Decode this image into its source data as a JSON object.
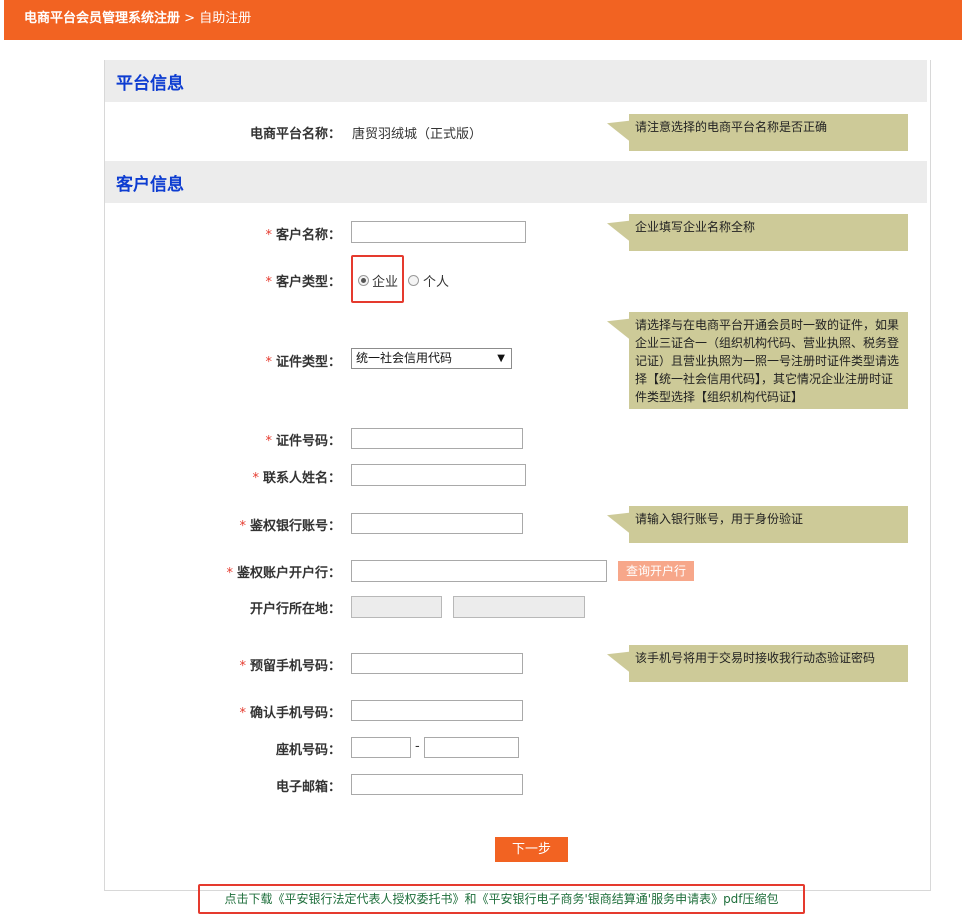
{
  "header": {
    "system_title": "电商平台会员管理系统注册",
    "separator": ">",
    "current_page": "自助注册"
  },
  "colors": {
    "brand": "#f26322",
    "section_title": "#0d3cd1",
    "tip_bg": "#cdca98",
    "required": "#e53a2e",
    "highlight_border": "#e53a2e"
  },
  "platform_section": {
    "title": "平台信息",
    "platform_name_label": "电商平台名称：",
    "platform_name_value": "唐贸羽绒城（正式版）",
    "platform_tip": "请注意选择的电商平台名称是否正确"
  },
  "customer_section": {
    "title": "客户信息",
    "required_mark": "*",
    "customer_name": {
      "label": "客户名称：",
      "value": "",
      "tip": "企业填写企业名称全称"
    },
    "customer_type": {
      "label": "客户类型：",
      "options": [
        "企业",
        "个人"
      ],
      "selected": "企业"
    },
    "id_type": {
      "label": "证件类型：",
      "selected": "统一社会信用代码",
      "arrow": "▼",
      "tip": "请选择与在电商平台开通会员时一致的证件，如果企业三证合一（组织机构代码、营业执照、税务登记证）且营业执照为一照一号注册时证件类型请选择【统一社会信用代码】，其它情况企业注册时证件类型选择【组织机构代码证】"
    },
    "id_number": {
      "label": "证件号码：",
      "value": ""
    },
    "contact_name": {
      "label": "联系人姓名：",
      "value": ""
    },
    "auth_bank_account": {
      "label": "鉴权银行账号：",
      "value": "",
      "tip": "请输入银行账号，用于身份验证"
    },
    "auth_bank_branch": {
      "label": "鉴权账户开户行：",
      "value": "",
      "query_button": "查询开户行"
    },
    "bank_location": {
      "label": "开户行所在地：",
      "province": "",
      "city": ""
    },
    "reserved_mobile": {
      "label": "预留手机号码：",
      "value": "",
      "tip": "该手机号将用于交易时接收我行动态验证密码"
    },
    "confirm_mobile": {
      "label": "确认手机号码：",
      "value": ""
    },
    "landline": {
      "label": "座机号码：",
      "area_code": "",
      "separator": "-",
      "number": ""
    },
    "email": {
      "label": "电子邮箱：",
      "value": ""
    }
  },
  "actions": {
    "next_button": "下一步"
  },
  "download_link": "点击下载《平安银行法定代表人授权委托书》和《平安银行电子商务'银商结算通'服务申请表》pdf压缩包"
}
